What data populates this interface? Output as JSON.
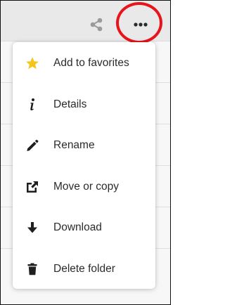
{
  "toolbar": {
    "share_icon": "share-icon",
    "more_icon": "more-options-icon",
    "highlight_color": "#e8141b"
  },
  "menu": {
    "items": [
      {
        "label": "Add to favorites",
        "icon": "star-icon",
        "icon_color": "#f5c518"
      },
      {
        "label": "Details",
        "icon": "info-icon",
        "icon_color": "#1f1f1f"
      },
      {
        "label": "Rename",
        "icon": "pencil-icon",
        "icon_color": "#1f1f1f"
      },
      {
        "label": "Move or copy",
        "icon": "external-link-icon",
        "icon_color": "#1f1f1f"
      },
      {
        "label": "Download",
        "icon": "download-icon",
        "icon_color": "#1f1f1f"
      },
      {
        "label": "Delete folder",
        "icon": "trash-icon",
        "icon_color": "#1f1f1f"
      }
    ]
  }
}
